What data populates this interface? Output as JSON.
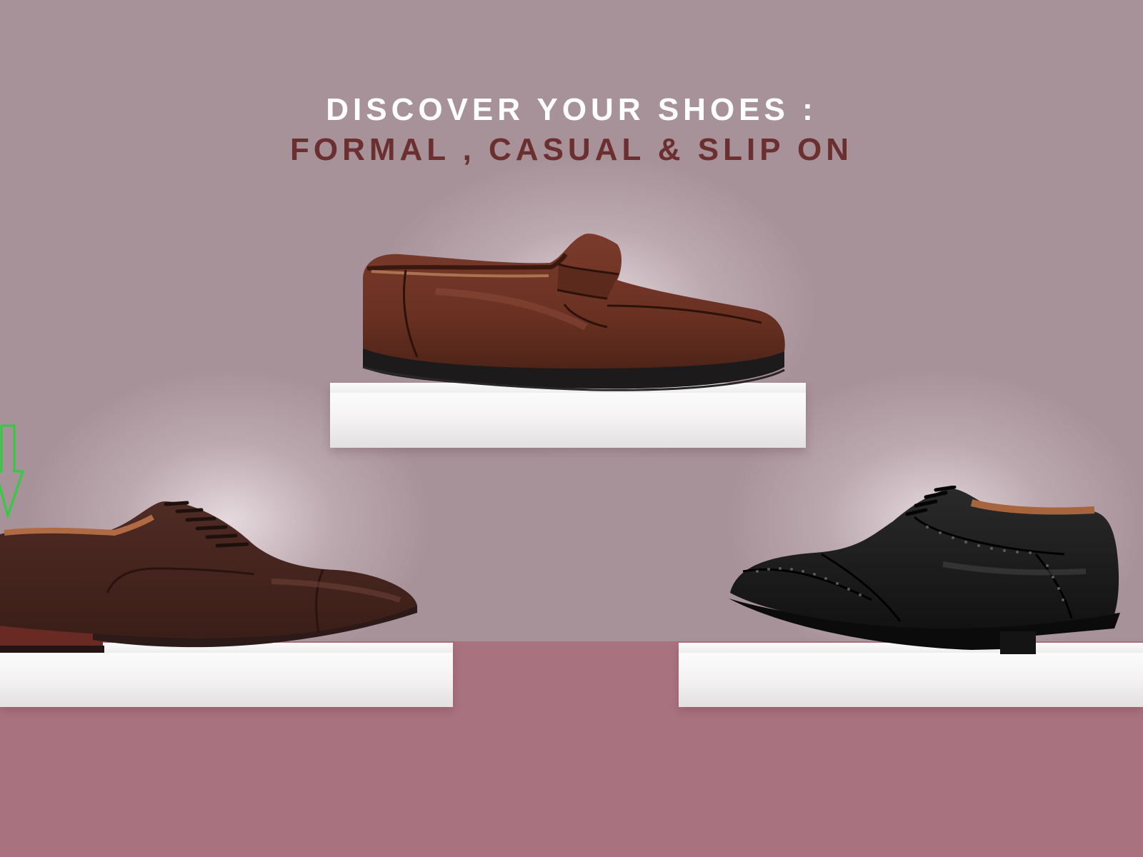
{
  "banner": {
    "headline_line1": "DISCOVER YOUR SHOES :",
    "headline_line2": "FORMAL , CASUAL & SLIP ON"
  },
  "colors": {
    "wall": "#a8929a",
    "floor": "#a9727f",
    "headline_white": "#ffffff",
    "headline_accent": "#6b2f30",
    "shelf": "#ffffff",
    "arrow": "#2ecc40"
  },
  "products": [
    {
      "name": "casual-slip-on-loafer",
      "color": "brown"
    },
    {
      "name": "formal-cap-toe-oxford",
      "color": "dark-brown"
    },
    {
      "name": "formal-brogue-derby",
      "color": "black"
    }
  ],
  "icons": {
    "arrow": "arrow-down-icon"
  }
}
